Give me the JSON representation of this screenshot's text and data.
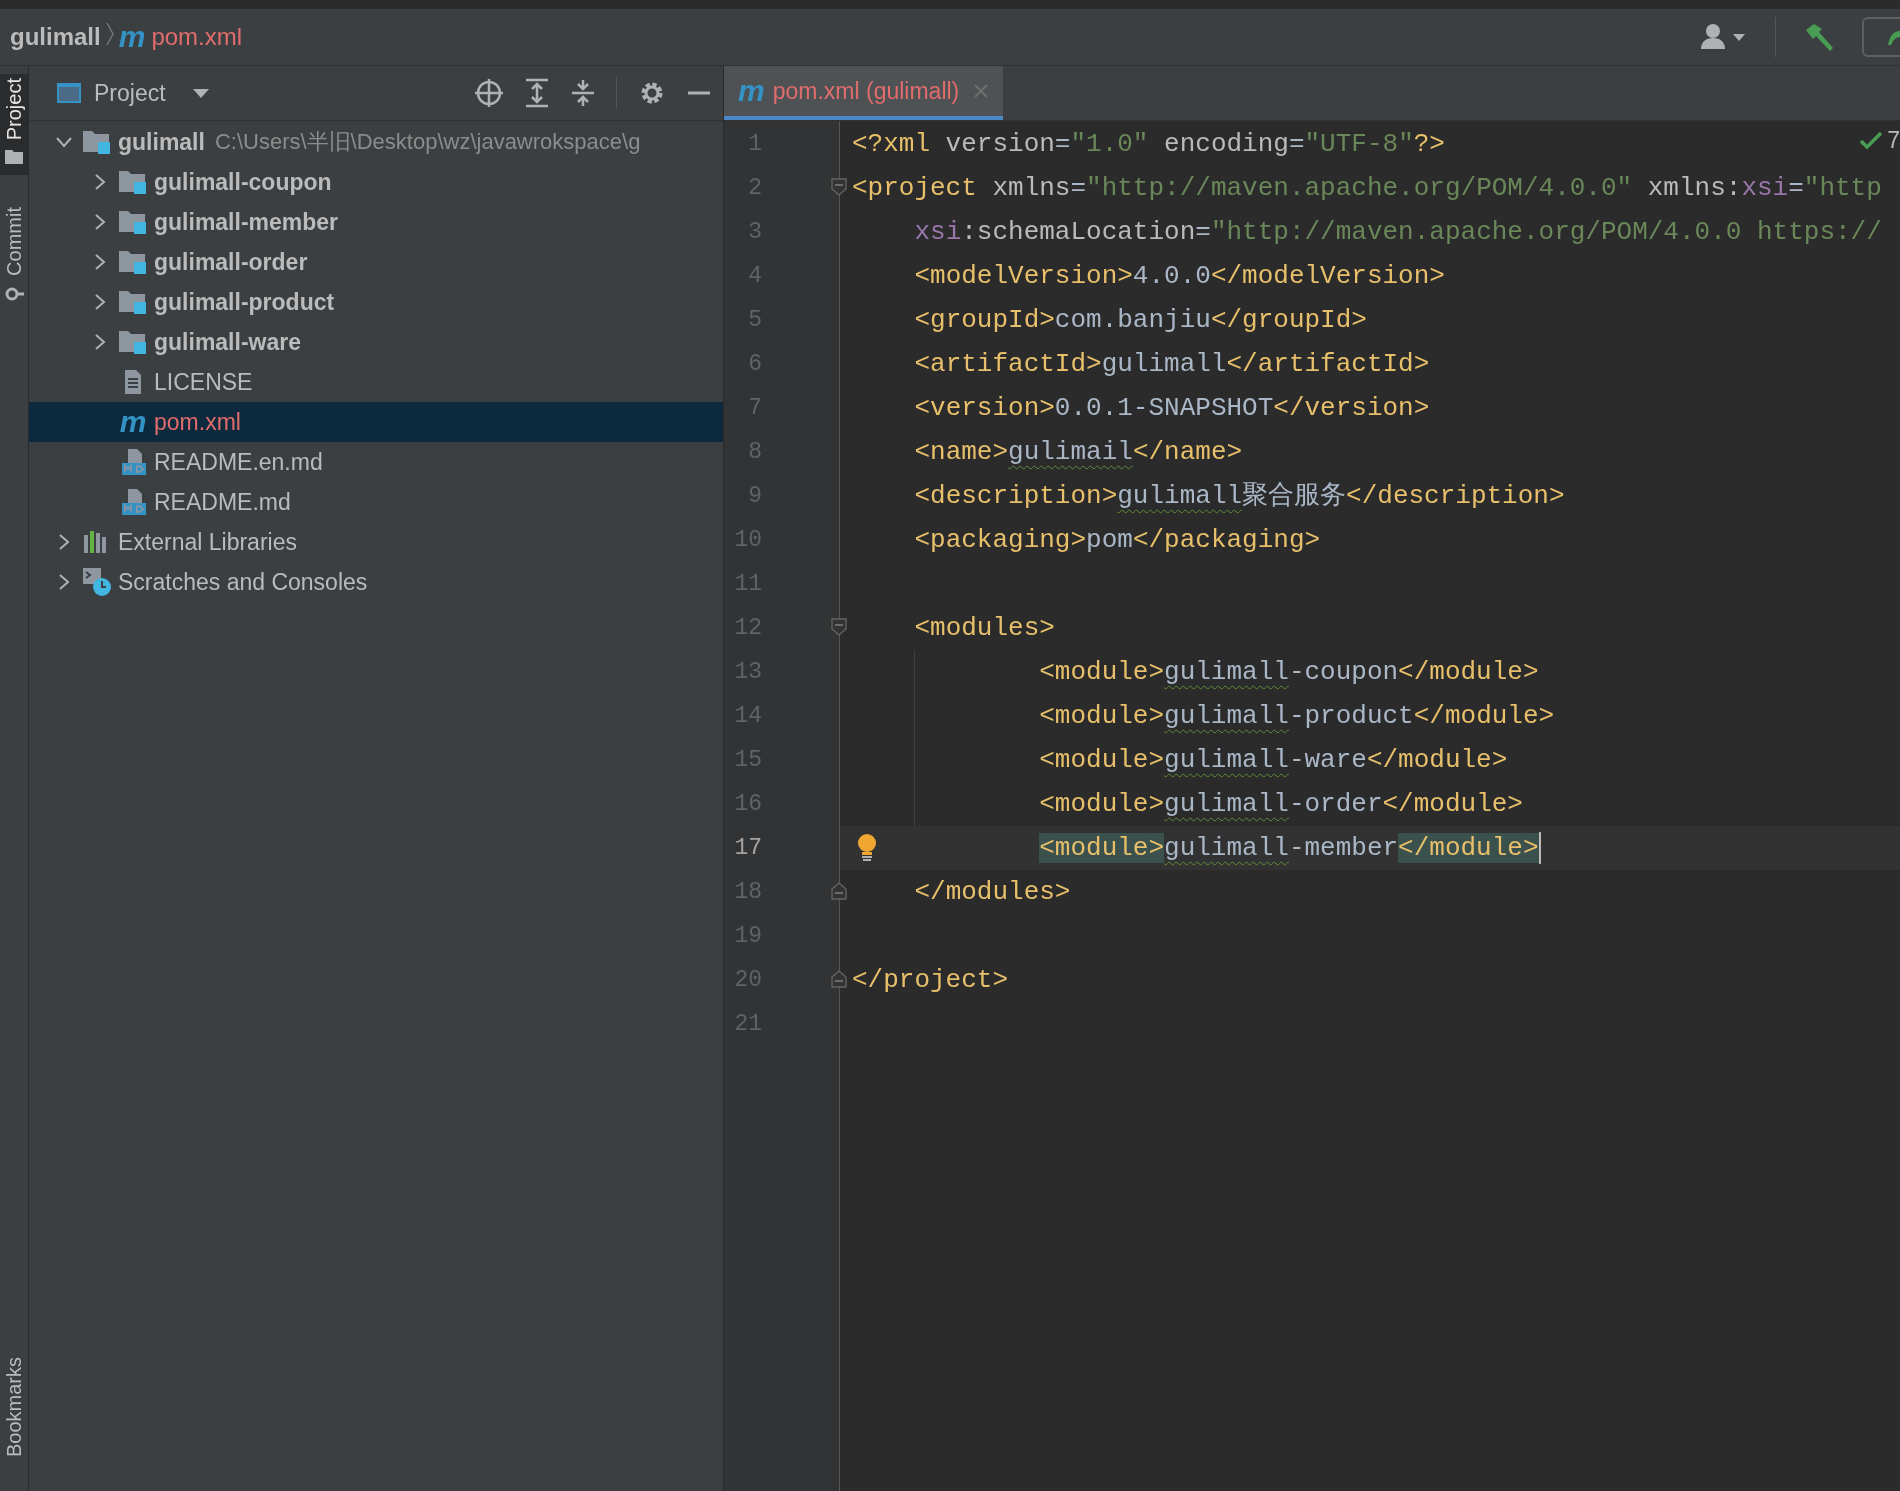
{
  "breadcrumbs": [
    {
      "label": "gulimall",
      "kind": "project"
    },
    {
      "label": "pom.xml",
      "kind": "maven",
      "glyph": "m",
      "color": "#e06c6c"
    }
  ],
  "tool_strip": [
    {
      "label": "Project",
      "kind": "folder",
      "selected": true
    },
    {
      "label": "Commit",
      "kind": "commit",
      "selected": false
    },
    {
      "label": "Bookmarks",
      "kind": "bookmark",
      "selected": false
    }
  ],
  "project_panel": {
    "title": "Project",
    "tree": [
      {
        "label": "gulimall",
        "kind": "project",
        "location": "C:\\Users\\半旧\\Desktop\\wz\\javawrokspace\\g",
        "expanded": true,
        "selected": false,
        "children": [
          {
            "label": "gulimall-coupon",
            "kind": "module",
            "expanded": false,
            "selected": false
          },
          {
            "label": "gulimall-member",
            "kind": "module",
            "expanded": false,
            "selected": false
          },
          {
            "label": "gulimall-order",
            "kind": "module",
            "expanded": false,
            "selected": false
          },
          {
            "label": "gulimall-product",
            "kind": "module",
            "expanded": false,
            "selected": false
          },
          {
            "label": "gulimall-ware",
            "kind": "module",
            "expanded": false,
            "selected": false
          },
          {
            "label": "LICENSE",
            "kind": "file",
            "selected": false
          },
          {
            "label": "pom.xml",
            "kind": "maven",
            "glyph": "m",
            "color": "#e06c6c",
            "selected": true
          },
          {
            "label": "README.en.md",
            "kind": "markdown",
            "selected": false
          },
          {
            "label": "README.md",
            "kind": "markdown",
            "selected": false
          }
        ]
      },
      {
        "label": "External Libraries",
        "kind": "libraries",
        "expanded": false,
        "selected": false
      },
      {
        "label": "Scratches and Consoles",
        "kind": "scratches",
        "expanded": false,
        "selected": false
      }
    ]
  },
  "editor": {
    "tabs": [
      {
        "label": "pom.xml (gulimall)",
        "glyph": "m",
        "color": "#e06c6c",
        "selected": true
      }
    ],
    "inspection_count": "7",
    "lines": [
      {
        "number": "1",
        "current": false,
        "tokens": [
          {
            "kind": "tag",
            "text": "<?xml"
          },
          {
            "kind": "attr",
            "text": " version"
          },
          {
            "kind": "text",
            "text": "="
          },
          {
            "kind": "value",
            "text": "\"1.0\""
          },
          {
            "kind": "attr",
            "text": " encoding"
          },
          {
            "kind": "text",
            "text": "="
          },
          {
            "kind": "value",
            "text": "\"UTF-8\""
          },
          {
            "kind": "tag",
            "text": "?>"
          }
        ]
      },
      {
        "number": "2",
        "current": false,
        "fold_open": true,
        "tokens": [
          {
            "kind": "tag",
            "text": "<project"
          },
          {
            "kind": "attr",
            "text": " xmlns"
          },
          {
            "kind": "text",
            "text": "="
          },
          {
            "kind": "value",
            "text": "\"http://maven.apache.org/POM/4.0.0\""
          },
          {
            "kind": "attr",
            "text": " xmlns:"
          },
          {
            "kind": "ns",
            "text": "xsi"
          },
          {
            "kind": "text",
            "text": "="
          },
          {
            "kind": "value",
            "text": "\"http"
          }
        ]
      },
      {
        "number": "3",
        "current": false,
        "tokens": [
          {
            "kind": "ns",
            "text": "    xsi"
          },
          {
            "kind": "attr",
            "text": ":schemaLocation"
          },
          {
            "kind": "text",
            "text": "="
          },
          {
            "kind": "value",
            "text": "\"http://maven.apache.org/POM/4.0.0 https://"
          }
        ]
      },
      {
        "number": "4",
        "current": false,
        "tokens": [
          {
            "kind": "tag",
            "text": "    <modelVersion>"
          },
          {
            "kind": "text",
            "text": "4.0.0"
          },
          {
            "kind": "tag",
            "text": "</modelVersion>"
          }
        ]
      },
      {
        "number": "5",
        "current": false,
        "tokens": [
          {
            "kind": "tag",
            "text": "    <groupId>"
          },
          {
            "kind": "text",
            "text": "com.banjiu"
          },
          {
            "kind": "tag",
            "text": "</groupId>"
          }
        ]
      },
      {
        "number": "6",
        "current": false,
        "tokens": [
          {
            "kind": "tag",
            "text": "    <artifactId>"
          },
          {
            "kind": "text",
            "text": "gulimall"
          },
          {
            "kind": "tag",
            "text": "</artifactId>"
          }
        ]
      },
      {
        "number": "7",
        "current": false,
        "tokens": [
          {
            "kind": "tag",
            "text": "    <version>"
          },
          {
            "kind": "text",
            "text": "0.0.1-SNAPSHOT"
          },
          {
            "kind": "tag",
            "text": "</version>"
          }
        ]
      },
      {
        "number": "8",
        "current": false,
        "tokens": [
          {
            "kind": "tag",
            "text": "    <name>"
          },
          {
            "kind": "typo",
            "text": "gulimail"
          },
          {
            "kind": "tag",
            "text": "</name>"
          }
        ]
      },
      {
        "number": "9",
        "current": false,
        "tokens": [
          {
            "kind": "tag",
            "text": "    <description>"
          },
          {
            "kind": "typo",
            "text": "gulimall"
          },
          {
            "kind": "text",
            "text": "聚合服务"
          },
          {
            "kind": "tag",
            "text": "</description>"
          }
        ]
      },
      {
        "number": "10",
        "current": false,
        "tokens": [
          {
            "kind": "tag",
            "text": "    <packaging>"
          },
          {
            "kind": "text",
            "text": "pom"
          },
          {
            "kind": "tag",
            "text": "</packaging>"
          }
        ]
      },
      {
        "number": "11",
        "current": false
      },
      {
        "number": "12",
        "current": false,
        "fold_open": true,
        "tokens": [
          {
            "kind": "tag",
            "text": "    <modules>"
          }
        ]
      },
      {
        "number": "13",
        "current": false,
        "tokens": [
          {
            "kind": "tag",
            "text": "            <module>"
          },
          {
            "kind": "typo",
            "text": "gulimall"
          },
          {
            "kind": "text",
            "text": "-coupon"
          },
          {
            "kind": "tag",
            "text": "</module>"
          }
        ]
      },
      {
        "number": "14",
        "current": false,
        "tokens": [
          {
            "kind": "tag",
            "text": "            <module>"
          },
          {
            "kind": "typo",
            "text": "gulimall"
          },
          {
            "kind": "text",
            "text": "-product"
          },
          {
            "kind": "tag",
            "text": "</module>"
          }
        ]
      },
      {
        "number": "15",
        "current": false,
        "tokens": [
          {
            "kind": "tag",
            "text": "            <module>"
          },
          {
            "kind": "typo",
            "text": "gulimall"
          },
          {
            "kind": "text",
            "text": "-ware"
          },
          {
            "kind": "tag",
            "text": "</module>"
          }
        ]
      },
      {
        "number": "16",
        "current": false,
        "tokens": [
          {
            "kind": "tag",
            "text": "            <module>"
          },
          {
            "kind": "typo",
            "text": "gulimall"
          },
          {
            "kind": "text",
            "text": "-order"
          },
          {
            "kind": "tag",
            "text": "</module>"
          }
        ]
      },
      {
        "number": "17",
        "current": true,
        "tokens": [
          {
            "kind": "match",
            "text": "            <module>"
          },
          {
            "kind": "typo",
            "text": "gulimall"
          },
          {
            "kind": "text",
            "text": "-member"
          },
          {
            "kind": "match",
            "text": "</module>"
          }
        ]
      },
      {
        "number": "18",
        "current": false,
        "fold_close": true,
        "tokens": [
          {
            "kind": "tag",
            "text": "    </modules>"
          }
        ]
      },
      {
        "number": "19",
        "current": false
      },
      {
        "number": "20",
        "current": false,
        "fold_close": true,
        "tokens": [
          {
            "kind": "tag",
            "text": "</project>"
          }
        ]
      },
      {
        "number": "21",
        "current": false
      }
    ]
  }
}
